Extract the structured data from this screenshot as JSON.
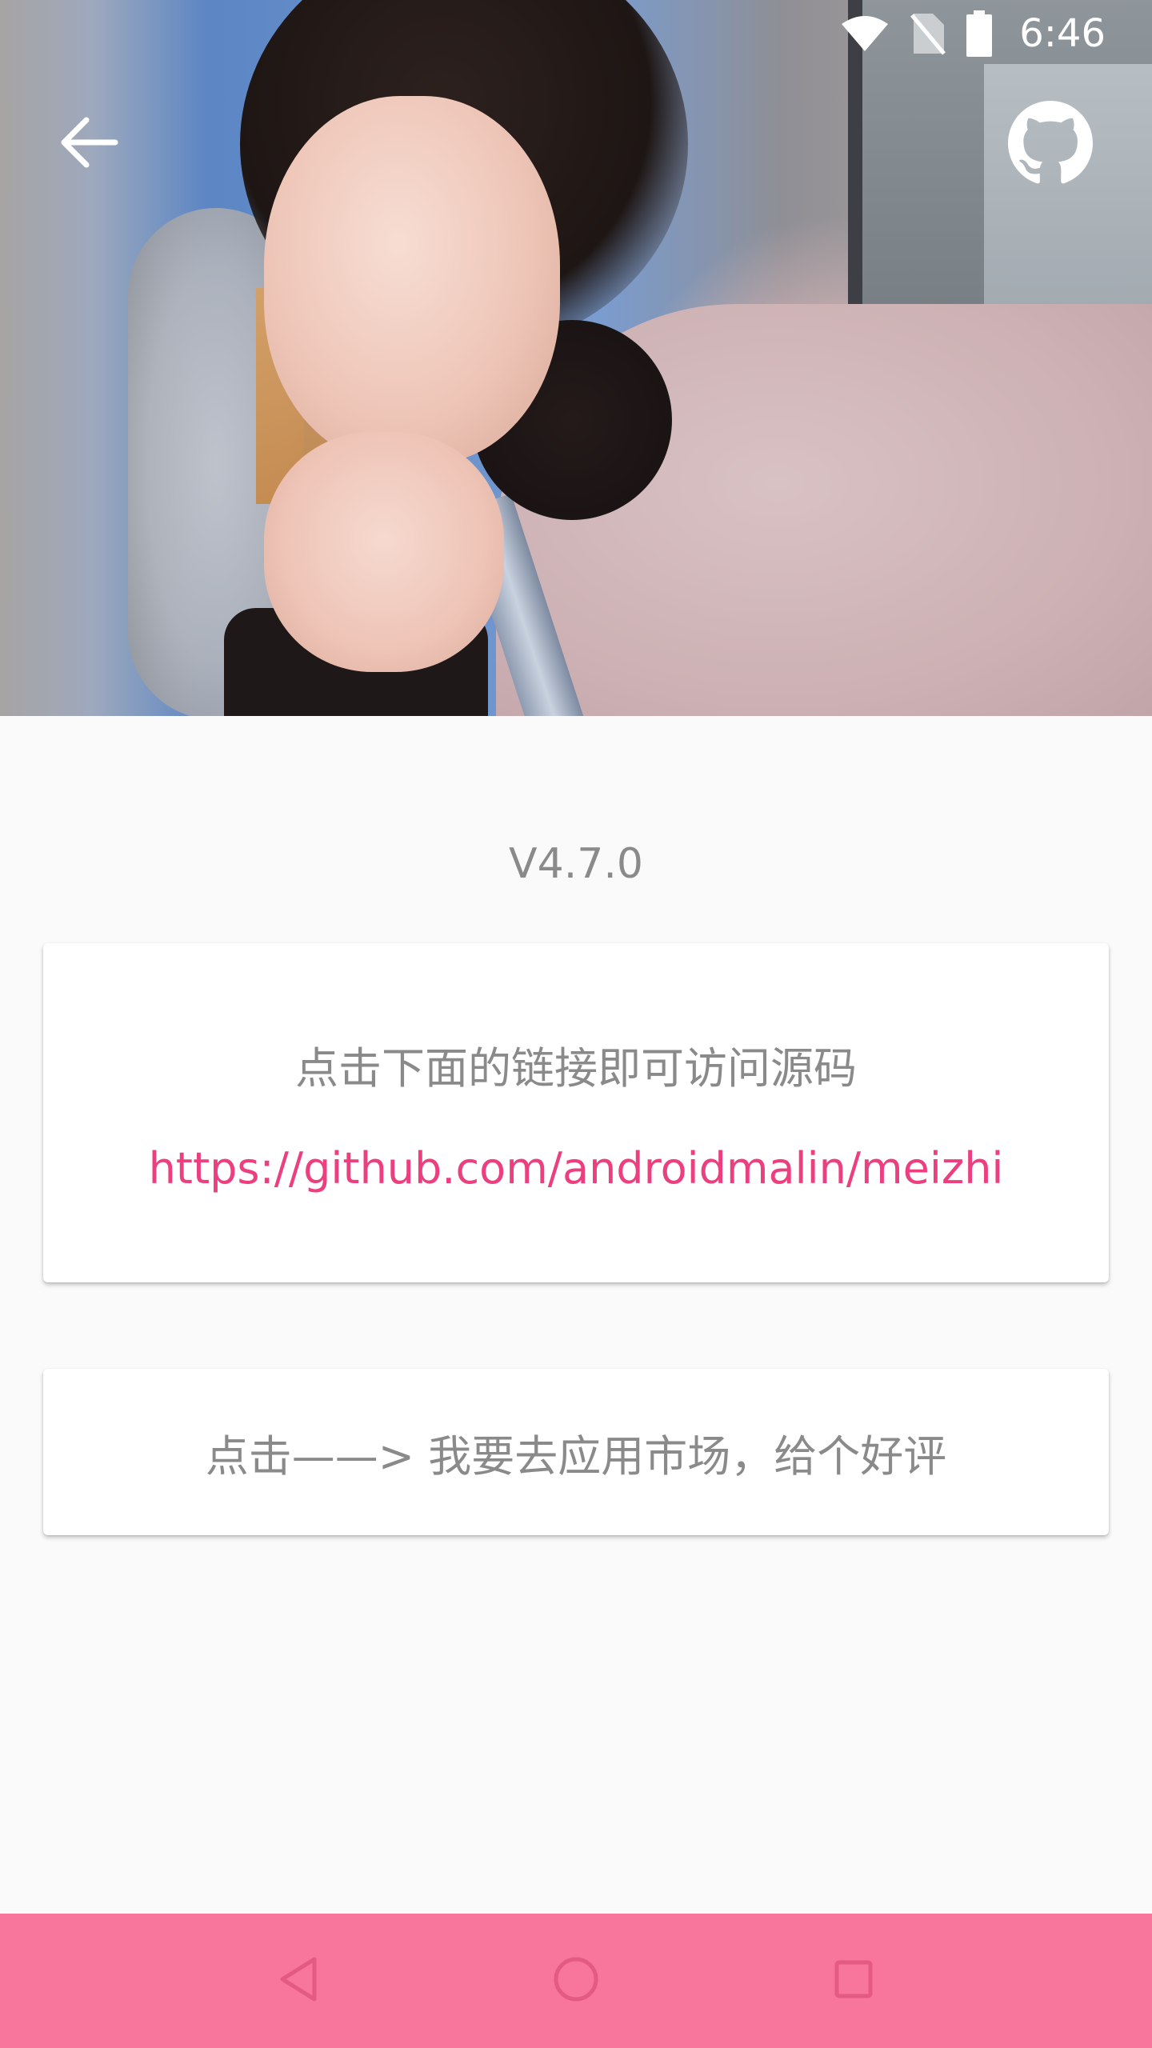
{
  "status_bar": {
    "time": "6:46",
    "icons": [
      "wifi-icon",
      "no-sim-icon",
      "battery-icon"
    ]
  },
  "app_bar": {
    "back_icon": "arrow-back-icon",
    "github_icon": "github-icon"
  },
  "content": {
    "version": "V4.7.0",
    "source_hint": "点击下面的链接即可访问源码",
    "source_link": "https://github.com/androidmalin/meizhi",
    "rate_text": "点击——> 我要去应用市场，给个好评"
  },
  "nav_bar": {
    "buttons": [
      "back-triangle-icon",
      "home-circle-icon",
      "recents-square-icon"
    ]
  },
  "colors": {
    "link": "#ec3f7f",
    "nav_bar": "#f8769b",
    "background": "#fafafa",
    "secondary_text": "#8a8a8a"
  }
}
